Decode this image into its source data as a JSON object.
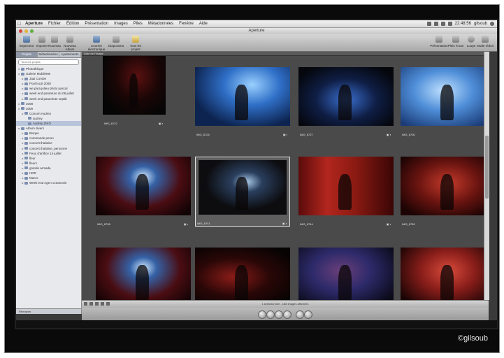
{
  "menubar": {
    "apple_icon": "apple-logo-icon",
    "items": [
      "Aperture",
      "Fichier",
      "Édition",
      "Présentation",
      "Images",
      "Piles",
      "Métadonnées",
      "Fenêtre",
      "Aide"
    ],
    "clock": "22:48:56",
    "user": "gilsoub"
  },
  "window": {
    "title": "Aperture"
  },
  "toolbar": {
    "inspector_label": "Inspecteur",
    "import_label": "Importer",
    "new_label": "Nouveau",
    "new_album_label": "Nouveau Album",
    "email_label": "Courrier électronique",
    "slideshow_label": "Diaporama",
    "all_projects_label": "Tous les projets",
    "presentation_label": "Présentation",
    "full_screen_label": "Plein écran",
    "loupe_label": "Loupe",
    "mode_label": "Mode réduit"
  },
  "sidebar": {
    "tabs": [
      "Projets",
      "Métadonnées",
      "Ajustements"
    ],
    "search_placeholder": "Tous les projets",
    "items": [
      {
        "label": "Photothèque",
        "depth": 0,
        "selected": false
      },
      {
        "label": "Galerie MobileMe",
        "depth": 0,
        "selected": false
      },
      {
        "label": "Jaai Combe",
        "depth": 1,
        "selected": false
      },
      {
        "label": "Pool local 2008",
        "depth": 1,
        "selected": false
      },
      {
        "label": "we para julieu photo pascal",
        "depth": 1,
        "selected": false
      },
      {
        "label": "week end paranture du 06 juillet",
        "depth": 1,
        "selected": false
      },
      {
        "label": "week end parachute septib",
        "depth": 1,
        "selected": false
      },
      {
        "label": "2008",
        "depth": 0,
        "selected": false
      },
      {
        "label": "2009",
        "depth": 0,
        "selected": false
      },
      {
        "label": "Concert Audrey",
        "depth": 1,
        "selected": false
      },
      {
        "label": "audrey",
        "depth": 2,
        "selected": false
      },
      {
        "label": "Audrey ZIKO",
        "depth": 2,
        "selected": true
      },
      {
        "label": "Album divers",
        "depth": 0,
        "selected": false
      },
      {
        "label": "Bisque",
        "depth": 1,
        "selected": false
      },
      {
        "label": "commande perso",
        "depth": 1,
        "selected": false
      },
      {
        "label": "concert thaïlaise",
        "depth": 1,
        "selected": false
      },
      {
        "label": "concert thaïlaise_personne",
        "depth": 1,
        "selected": false
      },
      {
        "label": "Feux d'artifice 14 juillet",
        "depth": 1,
        "selected": false
      },
      {
        "label": "fleur",
        "depth": 1,
        "selected": false
      },
      {
        "label": "fleurs",
        "depth": 1,
        "selected": false
      },
      {
        "label": "grande armada",
        "depth": 1,
        "selected": false
      },
      {
        "label": "HDR",
        "depth": 1,
        "selected": false
      },
      {
        "label": "Macro",
        "depth": 1,
        "selected": false
      },
      {
        "label": "Week end Agen oceanovie",
        "depth": 1,
        "selected": false
      }
    ],
    "bottom_label": "Rémayan"
  },
  "browser": {
    "top_label": "Date de l'image",
    "thumbnails": [
      {
        "label": "IMG_6722",
        "badge": "▣ ◐",
        "scene": "guitar-red"
      },
      {
        "label": "IMG_6724",
        "badge": "▣ ◐",
        "scene": "blue-singer"
      },
      {
        "label": "IMG_6727",
        "badge": "▣ ◐",
        "scene": "dark-blue-stage"
      },
      {
        "label": "IMG_6730",
        "badge": "▣ ◐",
        "scene": "blue-close"
      },
      {
        "label": "IMG_6738",
        "badge": "▣ ◐",
        "scene": "screen-stage"
      },
      {
        "label": "IMG_6741",
        "badge": "▣ ◐",
        "scene": "wide-stage"
      },
      {
        "label": "IMG_6744",
        "badge": "▣ ◐",
        "scene": "red-curtain-band"
      },
      {
        "label": "IMG_6750",
        "badge": "▣ ◐",
        "scene": "red-singer"
      },
      {
        "label": "",
        "badge": "",
        "scene": "screen-stage"
      },
      {
        "label": "",
        "badge": "",
        "scene": "guitar-dark"
      },
      {
        "label": "",
        "badge": "",
        "scene": "singer-blue-mic"
      },
      {
        "label": "",
        "badge": "",
        "scene": "singer-red-mic"
      }
    ]
  },
  "status_bar": {
    "text": "1 sélectionnée - 168 images affichées"
  },
  "watermark": "©gilsoub",
  "colors": {
    "stage_red": "#b3261e",
    "stage_blue": "#2f6fc7",
    "browser_bg": "#4a4a4a"
  }
}
